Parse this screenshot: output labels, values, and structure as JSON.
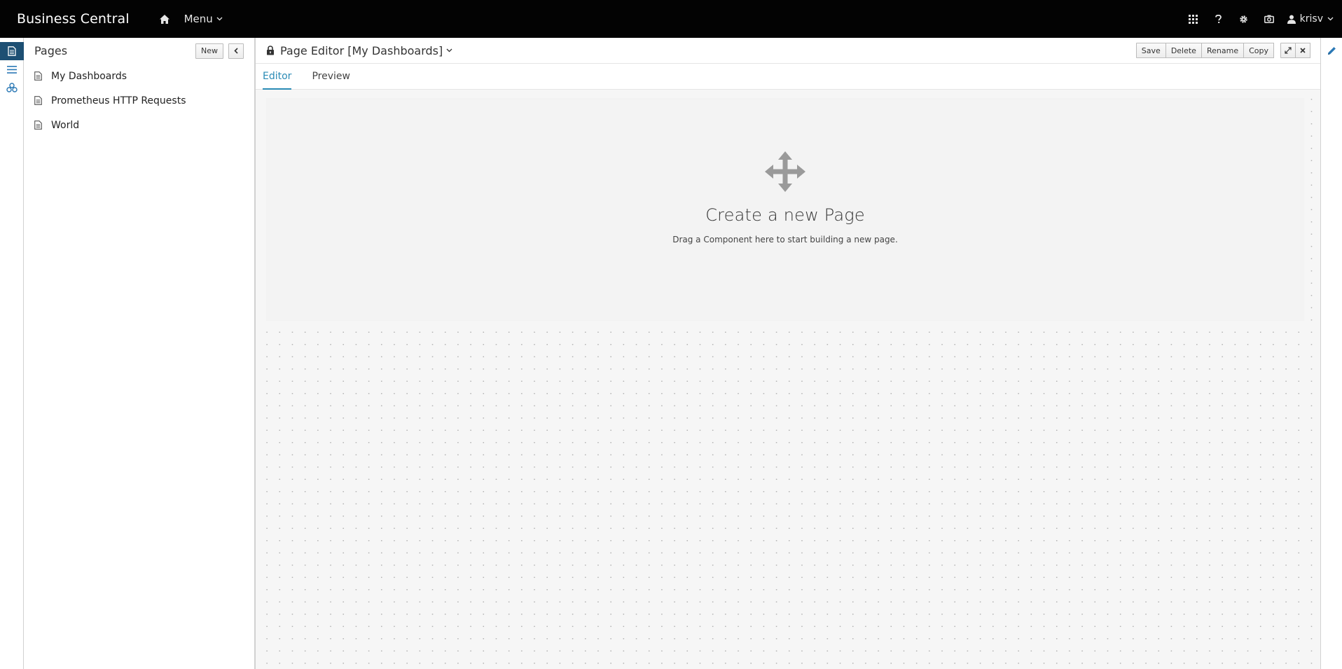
{
  "navbar": {
    "brand": "Business Central",
    "menu_label": "Menu",
    "user_name": "krisv",
    "icons": [
      "home-icon",
      "apps-grid-icon",
      "help-icon",
      "gear-icon",
      "camera-icon",
      "user-icon"
    ]
  },
  "rail": {
    "items": [
      "pages-icon",
      "list-icon",
      "datasets-icon"
    ]
  },
  "pages_panel": {
    "title": "Pages",
    "new_label": "New",
    "items": [
      {
        "label": "My Dashboards"
      },
      {
        "label": "Prometheus HTTP Requests"
      },
      {
        "label": "World"
      }
    ]
  },
  "editor": {
    "title": "Page Editor [My Dashboards]",
    "actions": {
      "save": "Save",
      "delete": "Delete",
      "rename": "Rename",
      "copy": "Copy"
    },
    "tabs": [
      {
        "label": "Editor",
        "active": true
      },
      {
        "label": "Preview",
        "active": false
      }
    ],
    "drop_zone": {
      "title": "Create a new Page",
      "subtitle": "Drag a Component here to start building a new page."
    }
  },
  "colors": {
    "navbar": "#030303",
    "accent": "#2a8bb5",
    "rail_active": "#1d4f73",
    "canvas": "#f6f6f6"
  }
}
